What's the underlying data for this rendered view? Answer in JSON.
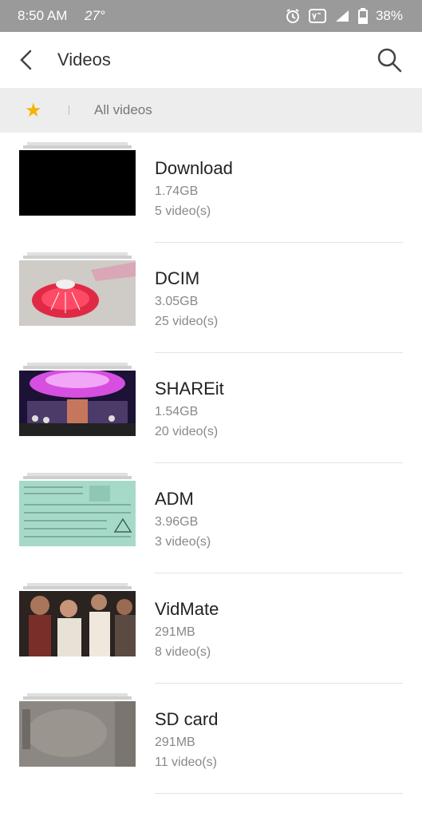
{
  "status_bar": {
    "time": "8:50 AM",
    "temperature": "27°",
    "battery": "38%"
  },
  "app_bar": {
    "title": "Videos"
  },
  "filter": {
    "label": "All videos"
  },
  "folders": [
    {
      "name": "Download",
      "size": "1.74GB",
      "count": "5 video(s)",
      "thumb": "black"
    },
    {
      "name": "DCIM",
      "size": "3.05GB",
      "count": "25 video(s)",
      "thumb": "rangoli"
    },
    {
      "name": "SHAREit",
      "size": "1.54GB",
      "count": "20 video(s)",
      "thumb": "stage"
    },
    {
      "name": "ADM",
      "size": "3.96GB",
      "count": "3 video(s)",
      "thumb": "document"
    },
    {
      "name": "VidMate",
      "size": "291MB",
      "count": "8 video(s)",
      "thumb": "people"
    },
    {
      "name": "SD card",
      "size": "291MB",
      "count": "11 video(s)",
      "thumb": "ground"
    }
  ]
}
